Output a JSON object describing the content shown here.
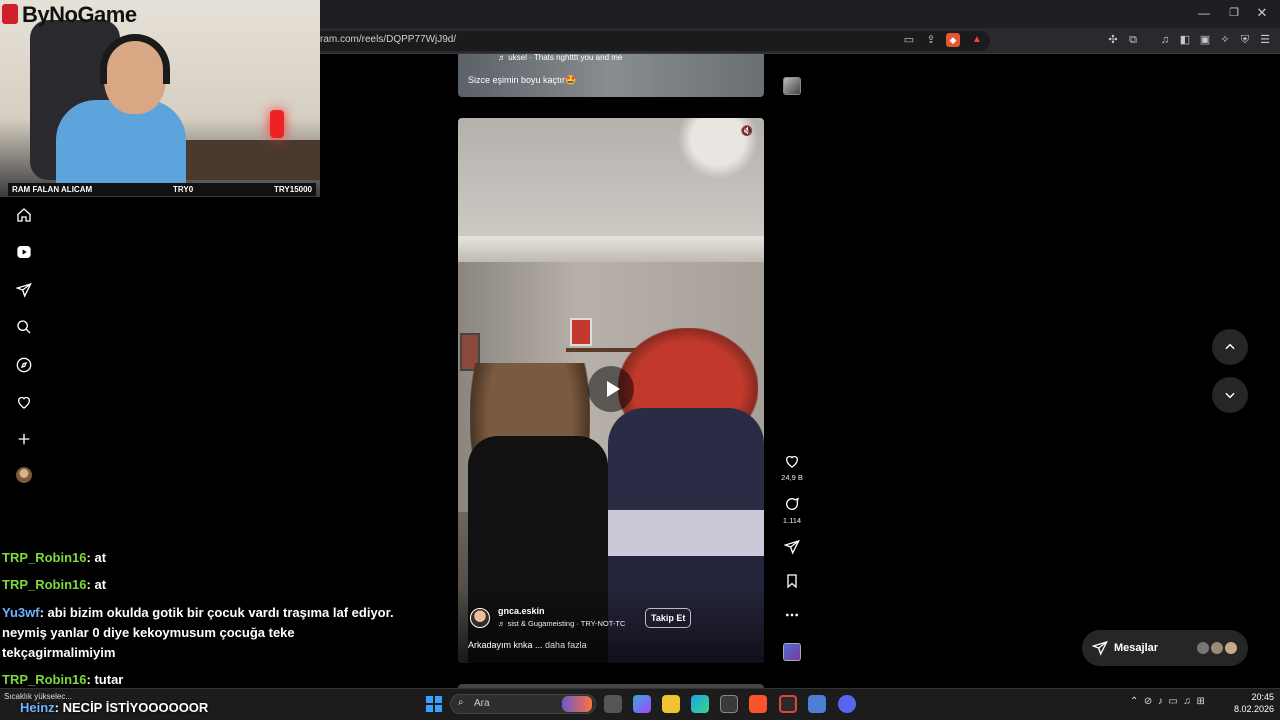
{
  "browser": {
    "url": "ram.com/reels/DQPP77WjJ9d/"
  },
  "stream": {
    "logo": "ByNoGame",
    "donation": {
      "goal_label": "RAM FALAN ALICAM",
      "current": "TRY0",
      "target": "TRY15000"
    }
  },
  "nav": {
    "items": [
      "home-icon",
      "reels-icon",
      "direct-icon",
      "search-icon",
      "explore-icon",
      "heart-icon",
      "create-icon",
      "profile-avatar"
    ]
  },
  "reels": {
    "previous": {
      "audio": "♬ uksel · Thats nghtttt you and me",
      "caption": "Sizce eşimin boyu kaçtır🤩"
    },
    "current": {
      "username": "gnca.eskin",
      "audio": "♬ sist & Gugameisting · TRY-NOT-TC",
      "follow_label": "Takip Et",
      "caption": "Arkadayım knka ...",
      "more_label": "daha fazla",
      "likes": "24,9 B",
      "comments": "1.114"
    }
  },
  "messages": {
    "label": "Mesajlar"
  },
  "chat": [
    {
      "user": "TRP_Robin16",
      "text": " at",
      "color": "green"
    },
    {
      "user": "TRP_Robin16",
      "text": " at",
      "color": "green"
    },
    {
      "user": "Yu3wf",
      "text": " abi bizim okulda gotik bir çocuk vardı traşıma laf ediyor. neymiş yanlar 0 diye kekoymusum çocuğa teke tekçagirmalimiyim",
      "color": "blue"
    },
    {
      "user": "TRP_Robin16",
      "text": " tutar",
      "color": "green"
    }
  ],
  "taskbar": {
    "weather": "Sıcaklık yükselec...",
    "overlay_user": "Heinz",
    "overlay_text": " NECİP İSTİYOOOOOOR",
    "search_placeholder": "Ara",
    "time": "20:45",
    "date": "8.02.2026"
  }
}
